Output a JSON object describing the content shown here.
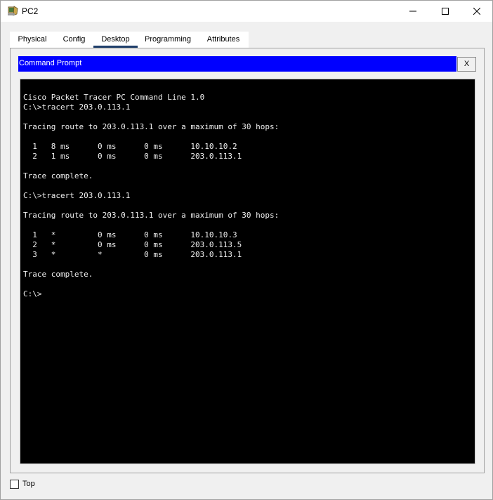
{
  "window": {
    "title": "PC2",
    "icon": "pc-icon"
  },
  "tabs": [
    {
      "label": "Physical",
      "active": false
    },
    {
      "label": "Config",
      "active": false
    },
    {
      "label": "Desktop",
      "active": true
    },
    {
      "label": "Programming",
      "active": false
    },
    {
      "label": "Attributes",
      "active": false
    }
  ],
  "command_prompt": {
    "title": "Command Prompt",
    "close_label": "X",
    "header_color": "#0000ff",
    "lines": [
      "Cisco Packet Tracer PC Command Line 1.0",
      "C:\\>tracert 203.0.113.1",
      "",
      "Tracing route to 203.0.113.1 over a maximum of 30 hops:",
      "",
      "  1   8 ms      0 ms      0 ms      10.10.10.2",
      "  2   1 ms      0 ms      0 ms      203.0.113.1",
      "",
      "Trace complete.",
      "",
      "C:\\>tracert 203.0.113.1",
      "",
      "Tracing route to 203.0.113.1 over a maximum of 30 hops:",
      "",
      "  1   *         0 ms      0 ms      10.10.10.3",
      "  2   *         0 ms      0 ms      203.0.113.5",
      "  3   *         *         0 ms      203.0.113.1",
      "",
      "Trace complete.",
      "",
      "C:\\>"
    ]
  },
  "footer": {
    "top_checkbox_label": "Top",
    "top_checked": false
  }
}
